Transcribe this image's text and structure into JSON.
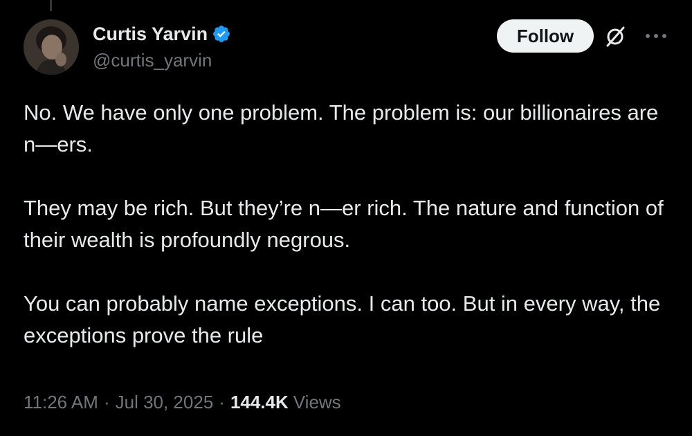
{
  "tweet": {
    "author": {
      "display_name": "Curtis Yarvin",
      "handle": "@curtis_yarvin",
      "verified": true,
      "verified_color": "#1d9bf0"
    },
    "follow_label": "Follow",
    "paragraphs": [
      "No. We have only one problem. The problem is: our billionaires are n—ers.",
      "They may be rich. But they’re n—er rich. The nature and function of their wealth is profoundly negrous.",
      "You can probably name exceptions. I can too. But in every way, the exceptions prove the rule"
    ],
    "time": "11:26 AM",
    "date": "Jul 30, 2025",
    "views_count": "144.4K",
    "views_label": "Views",
    "separator": "·"
  },
  "icons": {
    "badge": "verified-badge-icon",
    "grok": "grok-icon",
    "more": "more-icon"
  },
  "colors": {
    "background": "#000000",
    "text_primary": "#e7e9ea",
    "text_secondary": "#71767b",
    "follow_bg": "#eff3f4"
  }
}
